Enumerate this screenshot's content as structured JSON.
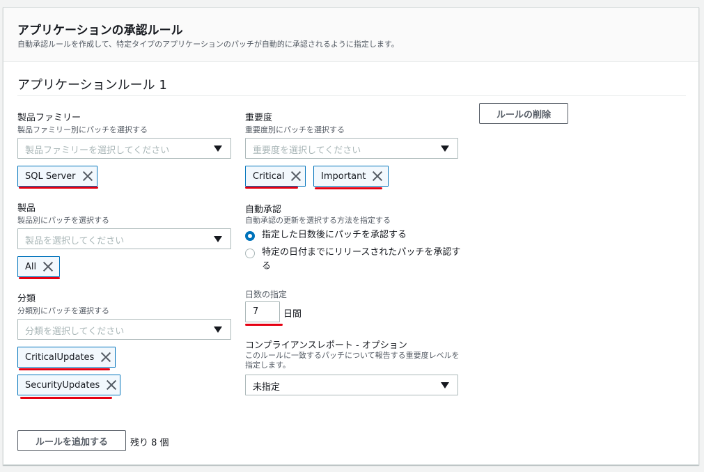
{
  "header": {
    "title": "アプリケーションの承認ルール",
    "description": "自動承認ルールを作成して、特定タイプのアプリケーションのパッチが自動的に承認されるように指定します。"
  },
  "rule": {
    "title": "アプリケーションルール 1",
    "delete_label": "ルールの削除"
  },
  "product_family": {
    "label": "製品ファミリー",
    "description": "製品ファミリー別にパッチを選択する",
    "placeholder": "製品ファミリーを選択してください",
    "tokens": [
      "SQL Server"
    ]
  },
  "product": {
    "label": "製品",
    "description": "製品別にパッチを選択する",
    "placeholder": "製品を選択してください",
    "tokens": [
      "All"
    ]
  },
  "classification": {
    "label": "分類",
    "description": "分類別にパッチを選択する",
    "placeholder": "分類を選択してください",
    "tokens": [
      "CriticalUpdates",
      "SecurityUpdates"
    ]
  },
  "severity": {
    "label": "重要度",
    "description": "重要度別にパッチを選択する",
    "placeholder": "重要度を選択してください",
    "tokens": [
      "Critical",
      "Important"
    ]
  },
  "auto_approval": {
    "label": "自動承認",
    "description": "自動承認の更新を選択する方法を指定する",
    "options": [
      {
        "label": "指定した日数後にパッチを承認する",
        "selected": true
      },
      {
        "label": "特定の日付までにリリースされたパッチを承認する",
        "selected": false
      }
    ]
  },
  "days": {
    "label": "日数の指定",
    "value": "7",
    "unit": "日間"
  },
  "compliance": {
    "label": "コンプライアンスレポート - オプション",
    "description": "このルールに一致するパッチについて報告する重要度レベルを指定します。",
    "value": "未指定"
  },
  "footer": {
    "add_label": "ルールを追加する",
    "remaining": "残り 8 個"
  },
  "colors": {
    "accent": "#0073bb",
    "annotation": "#e50012"
  }
}
